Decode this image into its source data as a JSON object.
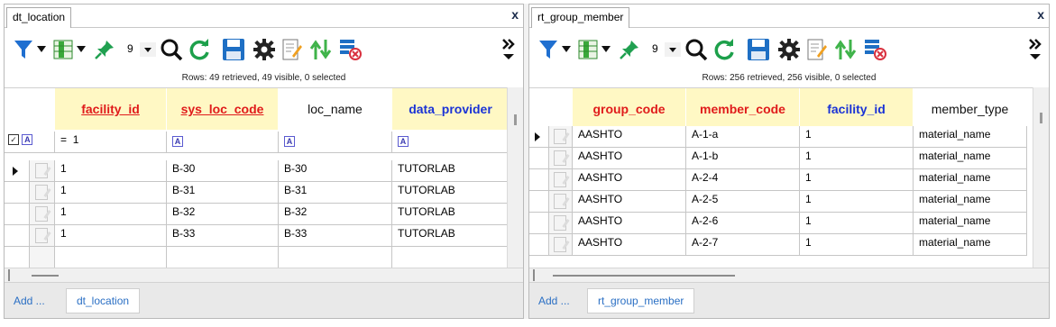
{
  "colors": {
    "accent": "#1e6fc4",
    "header_yellow": "#fff8c4",
    "red_text": "#e01b1b",
    "blue_text": "#1a33d6",
    "bottom_bg": "#e9e9e9"
  },
  "toolbar_icons": [
    "filter-icon",
    "column-chooser-icon",
    "pin-icon",
    "search-icon",
    "refresh-icon",
    "save-icon",
    "gear-icon",
    "edit-icon",
    "sort-icon",
    "clear-filter-icon",
    "overflow-icon"
  ],
  "left": {
    "tab_label": "dt_location",
    "close_label": "x",
    "toolbar_number": "9",
    "info": "Rows: 49 retrieved, 49 visible, 0 selected",
    "columns": [
      {
        "label": "facility_id",
        "style": "red"
      },
      {
        "label": "sys_loc_code",
        "style": "red"
      },
      {
        "label": "loc_name",
        "style": "black"
      },
      {
        "label": "data_provider",
        "style": "blue"
      }
    ],
    "filter_row": {
      "op": "=",
      "value": "1"
    },
    "rows": [
      [
        "1",
        "B-30",
        "B-30",
        "TUTORLAB"
      ],
      [
        "1",
        "B-31",
        "B-31",
        "TUTORLAB"
      ],
      [
        "1",
        "B-32",
        "B-32",
        "TUTORLAB"
      ],
      [
        "1",
        "B-33",
        "B-33",
        "TUTORLAB"
      ]
    ],
    "add_label": "Add ...",
    "bottom_button": "dt_location"
  },
  "right": {
    "tab_label": "rt_group_member",
    "close_label": "x",
    "toolbar_number": "9",
    "info": "Rows: 256 retrieved, 256 visible, 0 selected",
    "columns": [
      {
        "label": "group_code",
        "style": "red"
      },
      {
        "label": "member_code",
        "style": "red"
      },
      {
        "label": "facility_id",
        "style": "blue"
      },
      {
        "label": "member_type",
        "style": "black"
      }
    ],
    "rows": [
      [
        "AASHTO",
        "A-1-a",
        "1",
        "material_name"
      ],
      [
        "AASHTO",
        "A-1-b",
        "1",
        "material_name"
      ],
      [
        "AASHTO",
        "A-2-4",
        "1",
        "material_name"
      ],
      [
        "AASHTO",
        "A-2-5",
        "1",
        "material_name"
      ],
      [
        "AASHTO",
        "A-2-6",
        "1",
        "material_name"
      ],
      [
        "AASHTO",
        "A-2-7",
        "1",
        "material_name"
      ]
    ],
    "add_label": "Add ...",
    "bottom_button": "rt_group_member"
  }
}
